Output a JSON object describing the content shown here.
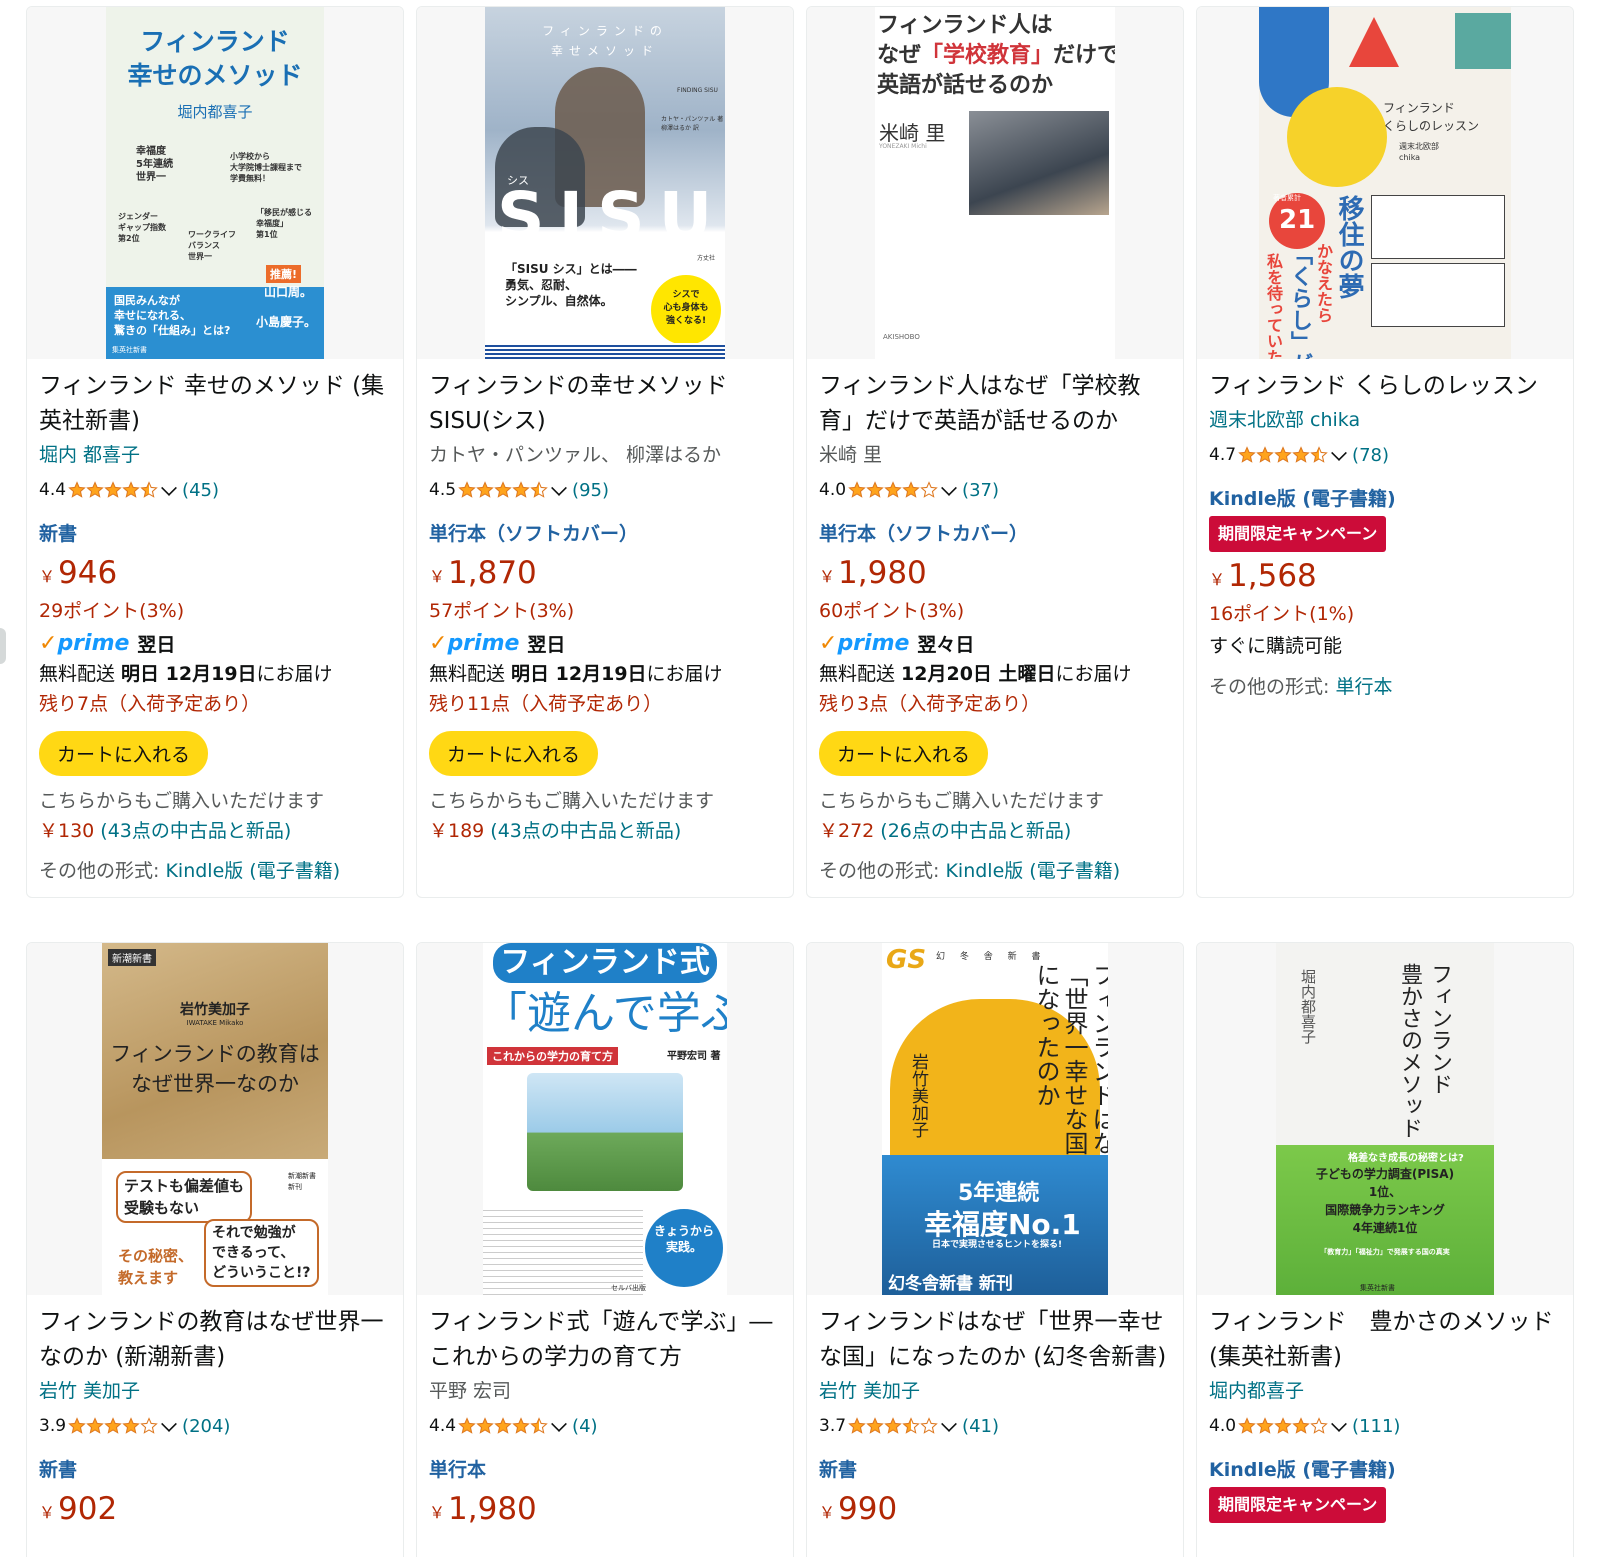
{
  "colors": {
    "link": "#007185",
    "price": "#b12704",
    "format": "#2162a1",
    "star": "#ffa41c",
    "cart": "#ffd814",
    "campaign": "#cc0c39"
  },
  "labels": {
    "add_to_cart": "カートに入れる",
    "buy_also": "こちらからもご購入いただけます",
    "other_formats_prefix": "その他の形式: ",
    "campaign": "期間限定キャンペーン",
    "yen": "￥"
  },
  "products": [
    {
      "title": "フィンランド 幸せのメソッド (集英社新書)",
      "author": "堀内 都喜子",
      "rating": "4.4",
      "stars": 4.5,
      "count": "(45)",
      "format": "新書",
      "price": "946",
      "points": "29ポイント(3%)",
      "prime_label": "翌日",
      "delivery_prefix": "無料配送 ",
      "delivery_bold": "明日 12月19日",
      "delivery_suffix": "にお届け",
      "stock": "残り7点（入荷予定あり）",
      "used_price": "￥130",
      "used_text": " (43点の中古品と新品)",
      "other_format": "Kindle版 (電子書籍)",
      "cover": {
        "title": "フィンランド\n幸せのメソッド",
        "author": "堀内都喜子",
        "badge1": "幸福度\n5年連続\n世界一",
        "badge2": "小学校から\n大学院博士課程まで\n学費無料！",
        "badge3": "ジェンダー\nギャップ指数\n第2位",
        "badge4": "「移民が感じる\n幸福度」\n第1位",
        "badge5": "ワークライフ\nバランス\n世界一",
        "footer": "国民みんなが\n幸せになれる、\n驚きの「仕組み」とは?",
        "rec": "推薦!",
        "rec1": "山口周。",
        "rec2": "小島慶子。",
        "publisher": "集英社新書"
      }
    },
    {
      "title": "フィンランドの幸せメソッド SISU(シス)",
      "author": "カトヤ・パンツァル、 柳澤はるか",
      "rating": "4.5",
      "stars": 4.5,
      "count": "(95)",
      "format": "単行本（ソフトカバー）",
      "price": "1,870",
      "points": "57ポイント(3%)",
      "prime_label": "翌日",
      "delivery_prefix": "無料配送 ",
      "delivery_bold": "明日 12月19日",
      "delivery_suffix": "にお届け",
      "stock": "残り11点（入荷予定あり）",
      "used_price": "￥189",
      "used_text": " (43点の中古品と新品)",
      "other_format": "",
      "cover": {
        "top": "フィンランドの\n幸せメソッド",
        "big": "SISU",
        "kana": "シス",
        "en": "FINDING SISU",
        "author": "カトヤ・パンツァル 著\n柳澤はるか 訳",
        "lead": "「SISU シス」とは――\n勇気、忍耐、\nシンプル、自然体。",
        "circle": "シスで\n心も身体も\n強くなる!",
        "publisher": "方丈社"
      }
    },
    {
      "title": "フィンランド人はなぜ「学校教育」だけで英語が話せるのか",
      "author": "米崎 里",
      "rating": "4.0",
      "stars": 4,
      "count": "(37)",
      "format": "単行本（ソフトカバー）",
      "price": "1,980",
      "points": "60ポイント(3%)",
      "prime_label": "翌々日",
      "delivery_prefix": "無料配送 ",
      "delivery_bold": "12月20日 土曜日",
      "delivery_suffix": "にお届け",
      "stock": "残り3点（入荷予定あり）",
      "used_price": "￥272",
      "used_text": " (26点の中古品と新品)",
      "other_format": "Kindle版 (電子書籍)",
      "cover": {
        "line1": "フィンランド人は",
        "line2a": "なぜ",
        "line2b": "「学校教育」",
        "line2c": "だけで",
        "line3": "英語が話せるのか",
        "author": "米崎 里",
        "author_en": "YONEZAKI Michi",
        "publisher": "AKISHOBO"
      }
    },
    {
      "title": "フィンランド くらしのレッスン",
      "author": "週末北欧部 chika",
      "rating": "4.7",
      "stars": 4.5,
      "count": "(78)",
      "format": "Kindle版 (電子書籍)",
      "campaign": true,
      "price": "1,568",
      "points": "16ポイント(1%)",
      "instant": "すぐに購読可能",
      "other_format": "単行本",
      "cover": {
        "title": "フィンランド\nくらしのレッスン",
        "author": "週末北欧部\nchika",
        "big1": "移住の夢",
        "big2": "かなえたら",
        "big3": "「くらし」が",
        "big4": "私を待っていた!",
        "count": "21",
        "count_label": "著者累計"
      }
    },
    {
      "title": "フィンランドの教育はなぜ世界一なのか (新潮新書)",
      "author": "岩竹 美加子",
      "rating": "3.9",
      "stars": 4,
      "count": "(204)",
      "format": "新書",
      "price": "902",
      "cover": {
        "series": "新潮新書",
        "author": "岩竹美加子",
        "author_en": "IWATAKE Mikako",
        "title": "フィンランドの教育は\nなぜ世界一なのか",
        "bubble1": "テストも偏差値も\n受験もない",
        "bubble2": "それで勉強が\nできるって、\nどういうこと!?",
        "secret": "その秘密、\n教えます",
        "new": "新潮新書\n新刊"
      }
    },
    {
      "title": "フィンランド式「遊んで学ぶ」―これからの学力の育て方",
      "author": "平野 宏司",
      "rating": "4.4",
      "stars": 4.5,
      "count": "(4)",
      "format": "単行本",
      "price": "1,980",
      "cover": {
        "top": "フィンランド式",
        "big": "「遊んで学ぶ」",
        "sub": "これからの学力の育て方",
        "author": "平野宏司 著",
        "circle": "きょうから\n実践。",
        "publisher": "セルバ出版"
      }
    },
    {
      "title": "フィンランドはなぜ「世界一幸せな国」になったのか (幻冬舎新書)",
      "author": "岩竹 美加子",
      "rating": "3.7",
      "stars": 3.5,
      "count": "(41)",
      "format": "新書",
      "price": "990",
      "cover": {
        "logo": "GS",
        "series": "幻 冬 舎 新 書",
        "vtitle": "フィンランドはなぜ\n「世界一幸せな国」\nになったのか",
        "author": "岩竹美加子",
        "band1": "5年連続",
        "band2": "幸福度No.1",
        "band3": "日本で実現させるヒントを探る!",
        "bottom": "幻冬舎新書 新刊"
      }
    },
    {
      "title": "フィンランド　豊かさのメソッド (集英社新書)",
      "author": "堀内都喜子",
      "rating": "4.0",
      "stars": 4,
      "count": "(111)",
      "format": "Kindle版 (電子書籍)",
      "campaign": true,
      "cover": {
        "vtitle": "フィンランド\n豊かさのメソッド",
        "author": "堀内都喜子",
        "green1": "格差なき成長の秘密とは?",
        "green2": "子どもの学力調査(PISA)\n1位、\n国際競争力ランキング\n4年連続1位",
        "green3": "「教育力」「福祉力」で発展する国の真実",
        "publisher": "集英社新書"
      }
    }
  ]
}
